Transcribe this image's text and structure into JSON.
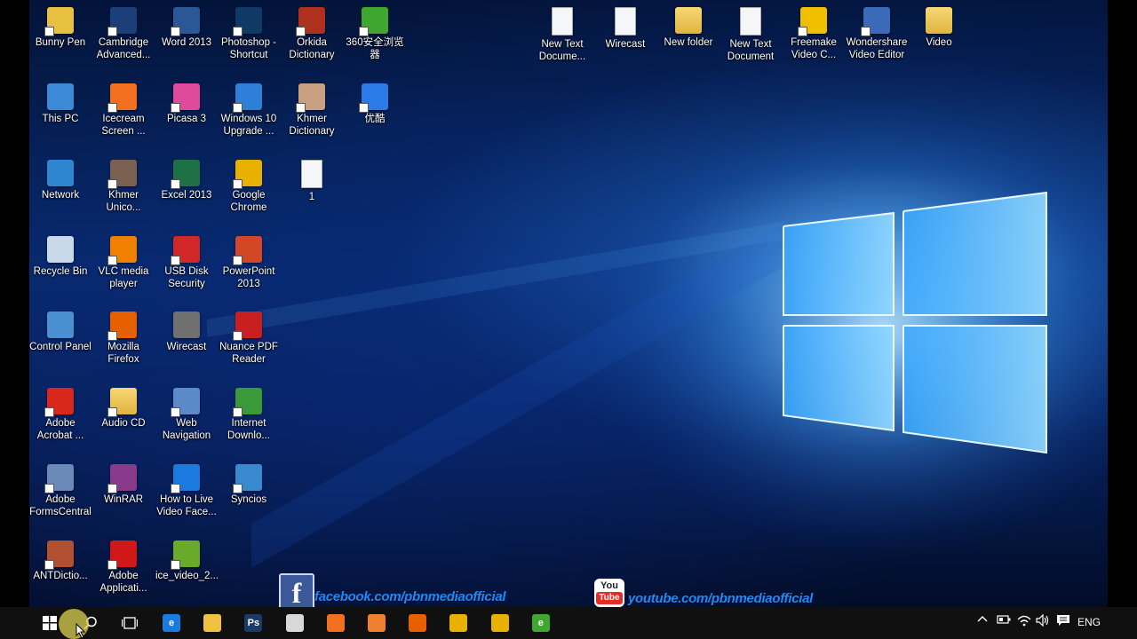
{
  "desktop_icons": [
    {
      "label": "Bunny Pen",
      "color": "#e8c040",
      "icon": "app-icon"
    },
    {
      "label": "Cambridge Advanced...",
      "color": "#1c3f7a",
      "icon": "app-icon"
    },
    {
      "label": "Word 2013",
      "color": "#2b5797",
      "icon": "word-icon"
    },
    {
      "label": "Photoshop - Shortcut",
      "color": "#0f3a66",
      "icon": "photoshop-icon"
    },
    {
      "label": "Orkida Dictionary",
      "color": "#b03020",
      "icon": "book-icon"
    },
    {
      "label": "360安全浏览器",
      "color": "#3fa62f",
      "icon": "browser-icon"
    },
    {
      "label": "This PC",
      "color": "#3a8ad8",
      "icon": "computer-icon"
    },
    {
      "label": "Icecream Screen ...",
      "color": "#f07020",
      "icon": "app-icon"
    },
    {
      "label": "Picasa 3",
      "color": "#e04a9a",
      "icon": "app-icon"
    },
    {
      "label": "Windows 10 Upgrade ...",
      "color": "#2d7fd8",
      "icon": "windows-icon"
    },
    {
      "label": "Khmer Dictionary",
      "color": "#c8a080",
      "icon": "book-icon"
    },
    {
      "label": "优酷",
      "color": "#2a7ae8",
      "icon": "video-icon"
    },
    {
      "label": "Network",
      "color": "#2e86d0",
      "icon": "network-icon"
    },
    {
      "label": "Khmer Unico...",
      "color": "#7a6050",
      "icon": "keyboard-icon"
    },
    {
      "label": "Excel 2013",
      "color": "#1e7145",
      "icon": "excel-icon"
    },
    {
      "label": "Google Chrome",
      "color": "#e8b100",
      "icon": "chrome-icon"
    },
    {
      "label": "1",
      "color": "#eeeeee",
      "icon": "document-icon"
    },
    {
      "label": "Recycle Bin",
      "color": "#c8d8e8",
      "icon": "recycle-bin-icon"
    },
    {
      "label": "VLC media player",
      "color": "#f08000",
      "icon": "vlc-icon"
    },
    {
      "label": "USB Disk Security",
      "color": "#d02828",
      "icon": "shield-icon"
    },
    {
      "label": "PowerPoint 2013",
      "color": "#d24726",
      "icon": "powerpoint-icon"
    },
    {
      "label": "Control Panel",
      "color": "#4a90d0",
      "icon": "control-panel-icon"
    },
    {
      "label": "Mozilla Firefox",
      "color": "#e66000",
      "icon": "firefox-icon"
    },
    {
      "label": "Wirecast",
      "color": "#707070",
      "icon": "app-icon"
    },
    {
      "label": "Nuance PDF Reader",
      "color": "#c82020",
      "icon": "pdf-icon"
    },
    {
      "label": "Adobe Acrobat ...",
      "color": "#d8281c",
      "icon": "pdf-icon"
    },
    {
      "label": "Audio CD",
      "color": "#e8c860",
      "icon": "folder-icon"
    },
    {
      "label": "Web Navigation",
      "color": "#5a8ac8",
      "icon": "globe-icon"
    },
    {
      "label": "Internet Downlo...",
      "color": "#3a9a3a",
      "icon": "download-icon"
    },
    {
      "label": "Adobe FormsCentral",
      "color": "#6a8ab8",
      "icon": "form-icon"
    },
    {
      "label": "WinRAR",
      "color": "#8a3a8a",
      "icon": "archive-icon"
    },
    {
      "label": "How to Live Video Face...",
      "color": "#1a7ae0",
      "icon": "video-icon"
    },
    {
      "label": "Syncios",
      "color": "#3a8ad0",
      "icon": "app-icon"
    },
    {
      "label": "ANTDictio...",
      "color": "#b05030",
      "icon": "app-icon"
    },
    {
      "label": "Adobe Applicati...",
      "color": "#d01818",
      "icon": "adobe-icon"
    },
    {
      "label": "ice_video_2...",
      "color": "#6aaa2a",
      "icon": "video-icon"
    },
    {
      "label": "New Text Docume...",
      "color": "#f4f6f8",
      "icon": "document-icon"
    },
    {
      "label": "Wirecast",
      "color": "#f4f6f8",
      "icon": "document-icon"
    },
    {
      "label": "New folder",
      "color": "#e8c040",
      "icon": "folder-icon"
    },
    {
      "label": "New Text Document",
      "color": "#f4f6f8",
      "icon": "document-icon"
    },
    {
      "label": "Freemake Video C...",
      "color": "#f0c000",
      "icon": "app-icon"
    },
    {
      "label": "Wondershare Video Editor",
      "color": "#3a6ab8",
      "icon": "app-icon"
    },
    {
      "label": "Video",
      "color": "#e8c040",
      "icon": "folder-icon"
    }
  ],
  "overlay": {
    "facebook_logo": "f",
    "facebook_text": "facebook.com/pbnmediaofficial",
    "youtube_logo_top": "You",
    "youtube_logo_bottom": "Tube",
    "youtube_text": "youtube.com/pbnmediaofficial"
  },
  "taskbar": {
    "pinned": [
      {
        "name": "edge",
        "color": "#1a7ae0",
        "glyph": "e"
      },
      {
        "name": "file-explorer",
        "color": "#f0c040",
        "glyph": ""
      },
      {
        "name": "photoshop",
        "color": "#1a3a6a",
        "glyph": "Ps"
      },
      {
        "name": "store",
        "color": "#d8d8d8",
        "glyph": ""
      },
      {
        "name": "icecream-recorder",
        "color": "#f07020",
        "glyph": ""
      },
      {
        "name": "icecream-screen",
        "color": "#f08030",
        "glyph": ""
      },
      {
        "name": "firefox",
        "color": "#e66000",
        "glyph": ""
      },
      {
        "name": "chrome",
        "color": "#e8b100",
        "glyph": ""
      },
      {
        "name": "chrome-2",
        "color": "#e8b100",
        "glyph": ""
      },
      {
        "name": "360-browser",
        "color": "#3fa62f",
        "glyph": "e"
      }
    ],
    "language": "ENG"
  },
  "colors": {
    "taskbar": "#101010",
    "desktop_accent": "#1a8cff"
  }
}
